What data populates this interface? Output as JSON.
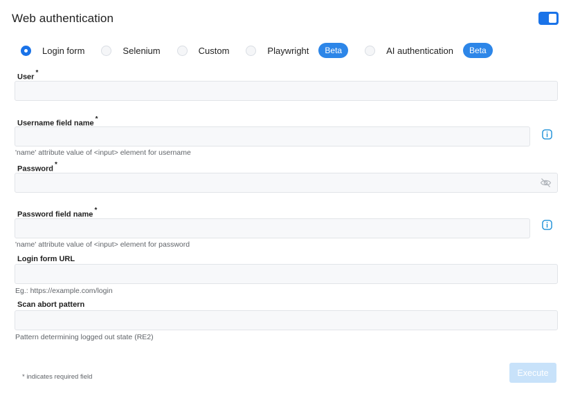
{
  "header": {
    "title": "Web authentication",
    "enabled": true
  },
  "auth_methods": [
    {
      "label": "Login form",
      "selected": true
    },
    {
      "label": "Selenium",
      "selected": false
    },
    {
      "label": "Custom",
      "selected": false
    },
    {
      "label": "Playwright",
      "selected": false,
      "badge": "Beta"
    },
    {
      "label": "AI authentication",
      "selected": false,
      "badge": "Beta"
    }
  ],
  "required_marker": "*",
  "fields": {
    "user": {
      "label": "User",
      "value": ""
    },
    "username_field": {
      "label": "Username field name",
      "value": "",
      "hint": "'name' attribute value of <input> element for username"
    },
    "password": {
      "label": "Password",
      "value": ""
    },
    "password_field": {
      "label": "Password field name",
      "value": "",
      "hint": "'name' attribute value of <input> element for password"
    },
    "login_url": {
      "label": "Login form URL",
      "value": "",
      "hint": "Eg.: https://example.com/login"
    },
    "scan_abort": {
      "label": "Scan abort pattern",
      "value": "",
      "hint": "Pattern determining logged out state (RE2)"
    }
  },
  "footer": {
    "required_note": "* indicates required field",
    "execute_label": "Execute"
  },
  "colors": {
    "accent": "#1a73e8",
    "badge": "#2d86e8",
    "execute_disabled": "#c8e2fa"
  },
  "icons": {
    "info": "info-icon",
    "password_visibility": "eye-off-icon"
  }
}
